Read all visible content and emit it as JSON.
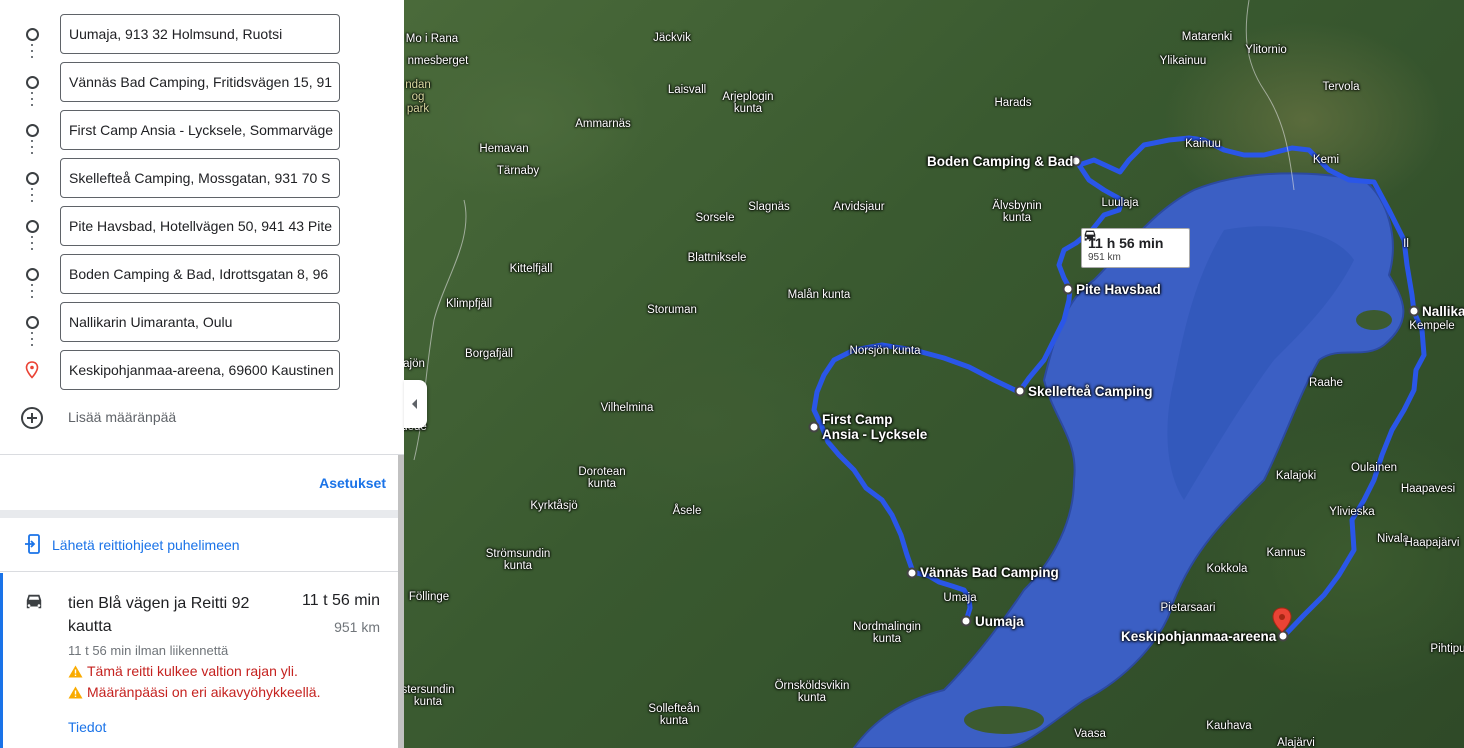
{
  "destinations": [
    {
      "value": "Uumaja, 913 32 Holmsund, Ruotsi",
      "icon": "circle-icon"
    },
    {
      "value": "Vännäs Bad Camping, Fritidsvägen 15, 91",
      "icon": "circle-icon"
    },
    {
      "value": "First Camp Ansia - Lycksele, Sommarväge",
      "icon": "circle-icon"
    },
    {
      "value": "Skellefteå Camping, Mossgatan, 931 70 S",
      "icon": "circle-icon"
    },
    {
      "value": "Pite Havsbad, Hotellvägen 50, 941 43 Pite",
      "icon": "circle-icon"
    },
    {
      "value": "Boden Camping & Bad, Idrottsgatan 8, 96",
      "icon": "circle-icon"
    },
    {
      "value": "Nallikarin Uimaranta, Oulu",
      "icon": "circle-icon"
    },
    {
      "value": "Keskipohjanmaa-areena, 69600 Kaustinen",
      "icon": "red-pin-icon"
    }
  ],
  "add_destination": "Lisää määränpää",
  "settings_label": "Asetukset",
  "send_label": "Lähetä reittiohjeet puhelimeen",
  "route": {
    "title": "tien Blå vägen ja Reitti 92 kautta",
    "time": "11 t 56 min",
    "distance": "951 km",
    "traffic_note": "11 t 56 min ilman liikennettä",
    "warning_1": "Tämä reitti kulkee valtion rajan yli.",
    "warning_2": "Määränpääsi on eri aikavyöhykkeellä.",
    "details_label": "Tiedot"
  },
  "map": {
    "route_color": "#2a56e8",
    "sea_color": "#3b63c8",
    "duration_box": {
      "duration": "11 h 56 min",
      "distance": "951 km"
    },
    "stops": [
      "Boden Camping & Bad",
      "Pite Havsbad",
      "Skellefteå Camping",
      "First Camp\nAnsia - Lycksele",
      "Vännäs Bad Camping",
      "Uumaja",
      "Nallika",
      "Keskipohjanmaa-areena"
    ],
    "places": [
      "Mo i Rana",
      "nmesberget",
      "ndan\nog\npark",
      "Jäckvik",
      "Laisvall",
      "Arjeplogin\nkunta",
      "Ammarnäs",
      "Hemavan",
      "Tärnaby",
      "Sorsele",
      "Slagnäs",
      "Arvidsjaur",
      "Älvsbynin\nkunta",
      "Luulaja",
      "Kainuu",
      "Kemi",
      "Harads",
      "Matarenki",
      "Ylitornio",
      "Ylikainuu",
      "Tervola",
      "Kittelfjäll",
      "Blattnikselе",
      "Klimpfjäll",
      "Malån kunta",
      "Storuman",
      "Borgafjäll",
      "Norsjön kunta",
      "Vilhelmina",
      "Dorotean\nkunta",
      "Kyrktåsjö",
      "Åsele",
      "Strömsundin\nkunta",
      "Föllinge",
      "Nordmalingin\nkunta",
      "Örnsköldsvikin\nkunta",
      "Sollefteån\nkunta",
      "stersundin\nkunta",
      "Vaasa",
      "Pietarsaari",
      "Kokkola",
      "Kannus",
      "Kalajoki",
      "Raahe",
      "Oulainen",
      "Ylivieska",
      "Nivala",
      "Haapavesi",
      "Haapajärvi",
      "Pihtipu",
      "Kauhava",
      "Alajärvi",
      "Kempele",
      "Il",
      "ajön",
      "dede",
      "Umaja"
    ]
  }
}
